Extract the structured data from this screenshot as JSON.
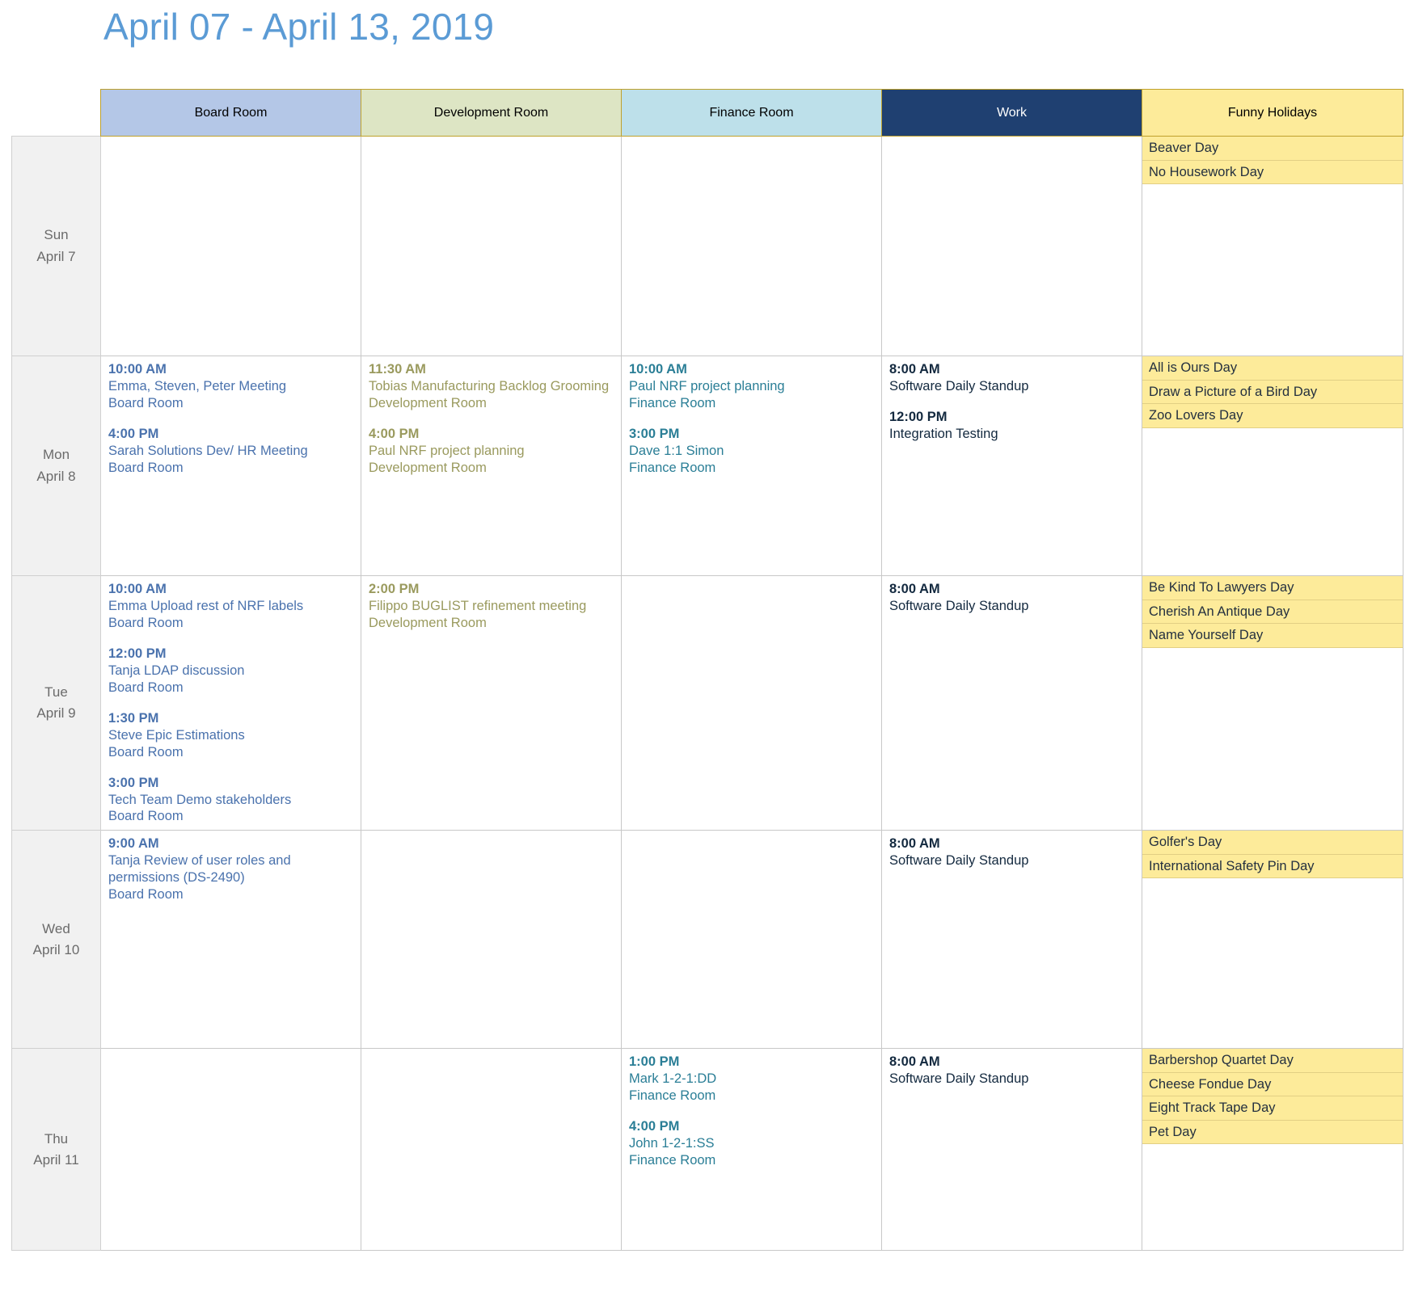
{
  "header": {
    "title": "April 07 - April 13, 2019"
  },
  "columns": [
    {
      "key": "board",
      "label": "Board Room",
      "bg": "#b4c7e7",
      "text": "#000000"
    },
    {
      "key": "dev",
      "label": "Development Room",
      "bg": "#dde5c4",
      "text": "#000000"
    },
    {
      "key": "fin",
      "label": "Finance Room",
      "bg": "#bde0ea",
      "text": "#000000"
    },
    {
      "key": "work",
      "label": "Work",
      "bg": "#1f4071",
      "text": "#ffffff"
    },
    {
      "key": "hol",
      "label": "Funny Holidays",
      "bg": "#fdeb9a",
      "text": "#000000"
    }
  ],
  "calendar_colors": {
    "board": "#4a72ad",
    "dev": "#9a9a5e",
    "fin": "#2a7e96",
    "work": "#13293f",
    "holiday_bg": "#fdeb9a",
    "title": "#5b9bd5",
    "daycell_bg": "#f1f1f1"
  },
  "days": [
    {
      "weekday": "Sun",
      "date": "April 7",
      "board": [],
      "dev": [],
      "fin": [],
      "work": [],
      "holidays": [
        "Beaver Day",
        "No Housework Day"
      ]
    },
    {
      "weekday": "Mon",
      "date": "April 8",
      "board": [
        {
          "time": "10:00 AM",
          "title": "Emma, Steven, Peter Meeting",
          "location": "Board Room"
        },
        {
          "time": "4:00 PM",
          "title": "Sarah Solutions Dev/ HR Meeting",
          "location": "Board Room"
        }
      ],
      "dev": [
        {
          "time": "11:30 AM",
          "title": "Tobias Manufacturing Backlog Grooming",
          "location": "Development Room"
        },
        {
          "time": "4:00 PM",
          "title": "Paul NRF project planning",
          "location": "Development Room"
        }
      ],
      "fin": [
        {
          "time": "10:00 AM",
          "title": "Paul NRF project planning",
          "location": "Finance Room"
        },
        {
          "time": "3:00 PM",
          "title": "Dave 1:1 Simon",
          "location": "Finance Room"
        }
      ],
      "work": [
        {
          "time": "8:00 AM",
          "title": "Software Daily Standup",
          "location": ""
        },
        {
          "time": "12:00 PM",
          "title": "Integration Testing",
          "location": ""
        }
      ],
      "holidays": [
        "All is Ours Day",
        "Draw a Picture of a Bird Day",
        "Zoo Lovers Day"
      ]
    },
    {
      "weekday": "Tue",
      "date": "April 9",
      "board": [
        {
          "time": "10:00 AM",
          "title": "Emma Upload rest of NRF labels",
          "location": "Board Room"
        },
        {
          "time": "12:00 PM",
          "title": "Tanja LDAP discussion",
          "location": "Board Room"
        },
        {
          "time": "1:30 PM",
          "title": "Steve Epic Estimations",
          "location": "Board Room"
        },
        {
          "time": "3:00 PM",
          "title": "Tech Team Demo stakeholders",
          "location": "Board Room"
        }
      ],
      "dev": [
        {
          "time": "2:00 PM",
          "title": "Filippo BUGLIST refinement meeting",
          "location": "Development Room"
        }
      ],
      "fin": [],
      "work": [
        {
          "time": "8:00 AM",
          "title": "Software Daily Standup",
          "location": ""
        }
      ],
      "holidays": [
        "Be Kind To Lawyers Day",
        "Cherish An Antique Day",
        "Name Yourself Day"
      ]
    },
    {
      "weekday": "Wed",
      "date": "April 10",
      "board": [
        {
          "time": "9:00 AM",
          "title": "Tanja Review of user roles and permissions (DS-2490)",
          "location": "Board Room"
        }
      ],
      "dev": [],
      "fin": [],
      "work": [
        {
          "time": "8:00 AM",
          "title": "Software Daily Standup",
          "location": ""
        }
      ],
      "holidays": [
        "Golfer's Day",
        "International Safety Pin Day"
      ]
    },
    {
      "weekday": "Thu",
      "date": "April 11",
      "board": [],
      "dev": [],
      "fin": [
        {
          "time": "1:00 PM",
          "title": "Mark 1-2-1:DD",
          "location": "Finance Room"
        },
        {
          "time": "4:00 PM",
          "title": "John 1-2-1:SS",
          "location": "Finance Room"
        }
      ],
      "work": [
        {
          "time": "8:00 AM",
          "title": "Software Daily Standup",
          "location": ""
        }
      ],
      "holidays": [
        "Barbershop Quartet Day",
        "Cheese Fondue Day",
        "Eight Track Tape Day",
        "Pet Day"
      ]
    }
  ]
}
